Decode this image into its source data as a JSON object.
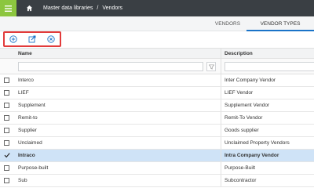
{
  "breadcrumb": {
    "root": "Master data libraries",
    "separator": "/",
    "current": "Vendors"
  },
  "tabs": [
    {
      "label": "VENDORS",
      "active": false
    },
    {
      "label": "VENDOR TYPES",
      "active": true
    }
  ],
  "toolbar": {
    "icons": [
      "add-circle-icon",
      "edit-icon",
      "delete-circle-icon"
    ]
  },
  "grid": {
    "columns": [
      "Name",
      "Description"
    ],
    "rows": [
      {
        "name": "Interco",
        "description": "Inter Company Vendor",
        "checked": false
      },
      {
        "name": "LIEF",
        "description": "LIEF Vendor",
        "checked": false
      },
      {
        "name": "Supplement",
        "description": "Supplement Vendor",
        "checked": false
      },
      {
        "name": "Remit-to",
        "description": "Remit-To Vendor",
        "checked": false
      },
      {
        "name": "Supplier",
        "description": "Goods supplier",
        "checked": false
      },
      {
        "name": "Unclaimed",
        "description": "Unclaimed Property Vendors",
        "checked": false
      },
      {
        "name": "Intraco",
        "description": "Intra Company Vendor",
        "checked": true
      },
      {
        "name": "Purpose-built",
        "description": "Purpose-Built",
        "checked": false
      },
      {
        "name": "Sub",
        "description": "Subcontractor",
        "checked": false
      }
    ]
  },
  "colors": {
    "topbar": "#3a3f44",
    "menu": "#8cc63f",
    "accent": "#1a73c8",
    "selected_row": "#cfe3f7",
    "highlight_box": "#e23b3b"
  }
}
